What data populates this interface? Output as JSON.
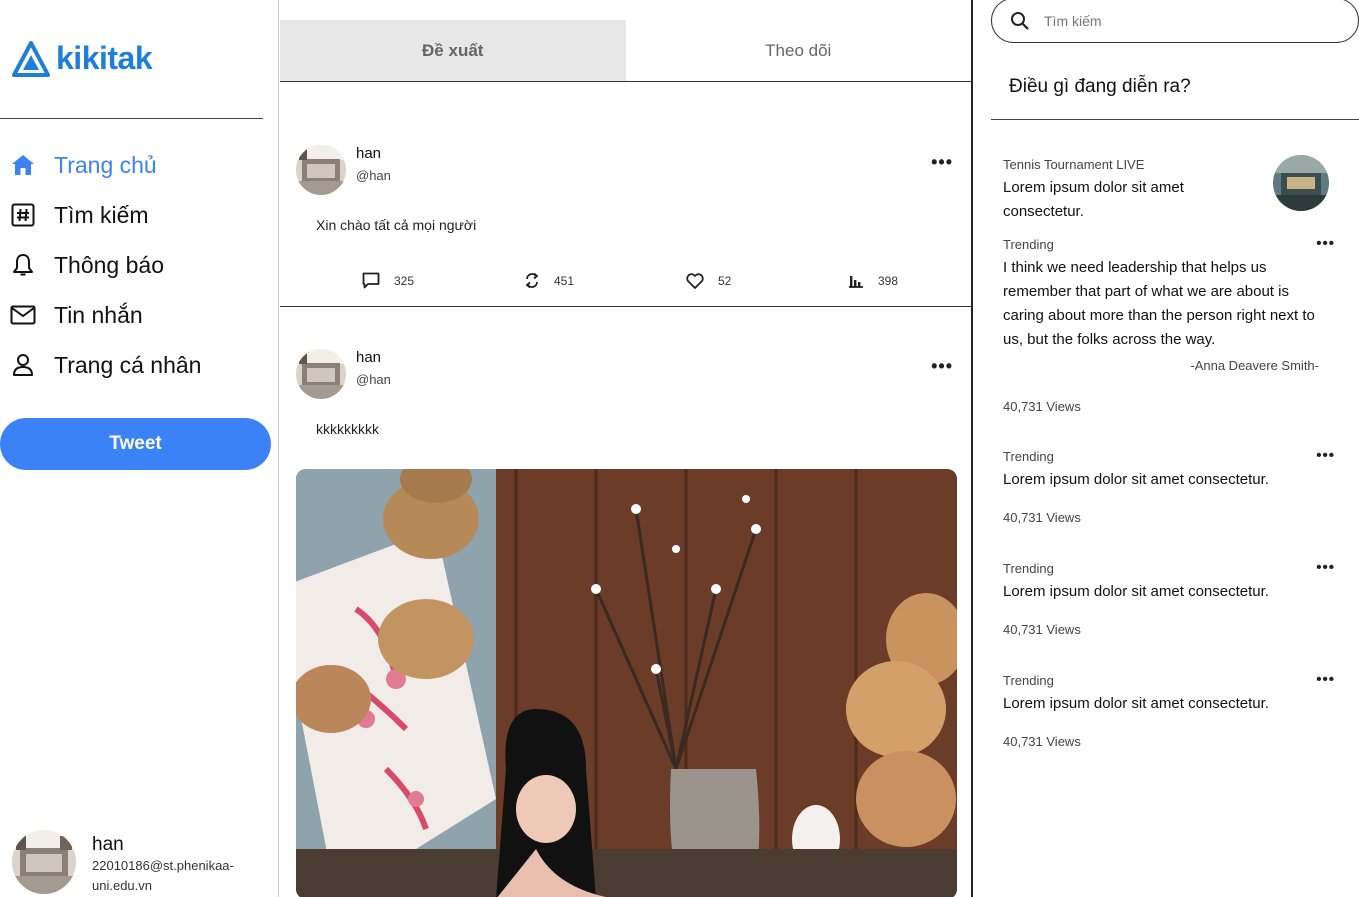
{
  "brand": {
    "name": "kikitak",
    "color": "#1d7fd8"
  },
  "accent": "#3b82f6",
  "nav": [
    {
      "label": "Trang chủ",
      "icon": "home-icon",
      "active": true
    },
    {
      "label": "Tìm kiếm",
      "icon": "hashtag-icon",
      "active": false
    },
    {
      "label": "Thông báo",
      "icon": "bell-icon",
      "active": false
    },
    {
      "label": "Tin nhắn",
      "icon": "mail-icon",
      "active": false
    },
    {
      "label": "Trang cá nhân",
      "icon": "user-icon",
      "active": false
    }
  ],
  "tweet_button": "Tweet",
  "profile": {
    "name": "han",
    "email": "22010186@st.phenikaa-uni.edu.vn"
  },
  "tabs": [
    {
      "label": "Đề xuất",
      "active": true
    },
    {
      "label": "Theo dõi",
      "active": false
    }
  ],
  "posts": [
    {
      "name": "han",
      "handle": "@han",
      "text": "Xin chào tất cả mọi người",
      "stats": {
        "replies": "325",
        "retweets": "451",
        "likes": "52",
        "views": "398"
      }
    },
    {
      "name": "han",
      "handle": "@han",
      "text": "kkkkkkkkk"
    }
  ],
  "search": {
    "placeholder": "Tìm kiếm"
  },
  "right": {
    "heading": "Điều gì đang diễn ra?",
    "trends": [
      {
        "category": "Tennis Tournament LIVE",
        "title": "Lorem ipsum dolor sit amet consectetur."
      },
      {
        "category": "Trending",
        "title": "I think we need leadership that helps us remember that part of what we are about is caring about more than the person right next to us, but the folks across the way.",
        "author": "-Anna Deavere Smith-",
        "views": "40,731 Views"
      },
      {
        "category": "Trending",
        "title": "Lorem ipsum dolor sit amet consectetur.",
        "views": "40,731 Views"
      },
      {
        "category": "Trending",
        "title": "Lorem ipsum dolor sit amet consectetur.",
        "views": "40,731 Views"
      },
      {
        "category": "Trending",
        "title": "Lorem ipsum dolor sit amet consectetur.",
        "views": "40,731 Views"
      }
    ]
  }
}
